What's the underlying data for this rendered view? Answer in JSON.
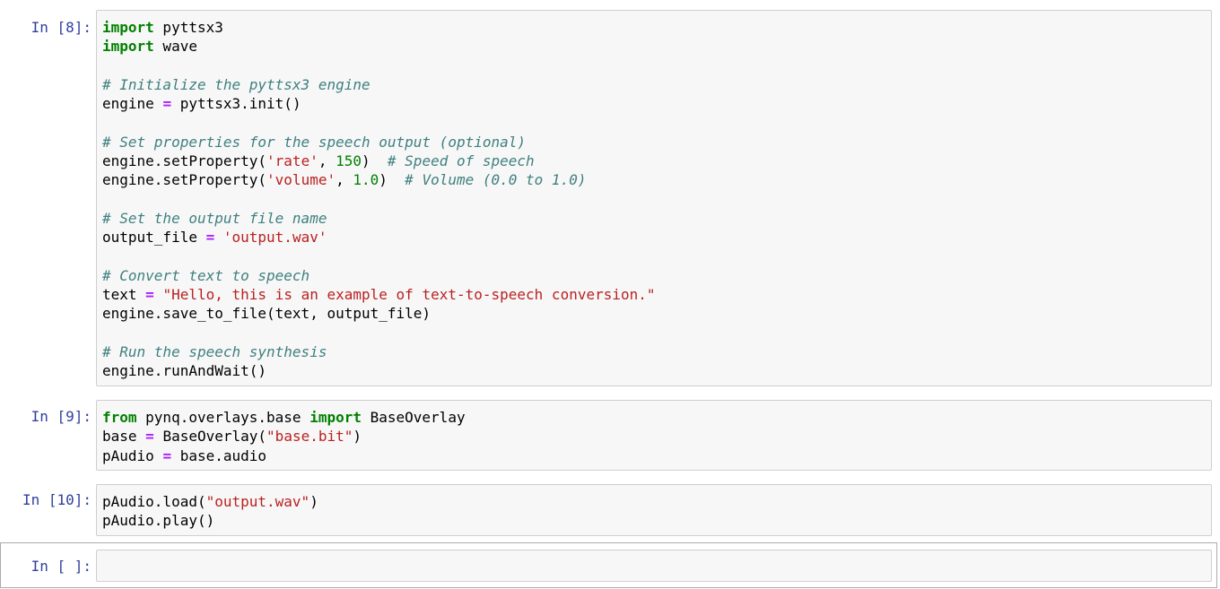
{
  "cells": [
    {
      "prompt": "In [8]:",
      "lines": [
        [
          {
            "t": "kw",
            "v": "import"
          },
          {
            "t": "",
            "v": " pyttsx3"
          }
        ],
        [
          {
            "t": "kw",
            "v": "import"
          },
          {
            "t": "",
            "v": " wave"
          }
        ],
        [],
        [
          {
            "t": "cm",
            "v": "# Initialize the pyttsx3 engine"
          }
        ],
        [
          {
            "t": "",
            "v": "engine "
          },
          {
            "t": "op",
            "v": "="
          },
          {
            "t": "",
            "v": " pyttsx3.init()"
          }
        ],
        [],
        [
          {
            "t": "cm",
            "v": "# Set properties for the speech output (optional)"
          }
        ],
        [
          {
            "t": "",
            "v": "engine.setProperty("
          },
          {
            "t": "st",
            "v": "'rate'"
          },
          {
            "t": "",
            "v": ", "
          },
          {
            "t": "nm",
            "v": "150"
          },
          {
            "t": "",
            "v": ")  "
          },
          {
            "t": "cm",
            "v": "# Speed of speech"
          }
        ],
        [
          {
            "t": "",
            "v": "engine.setProperty("
          },
          {
            "t": "st",
            "v": "'volume'"
          },
          {
            "t": "",
            "v": ", "
          },
          {
            "t": "nm",
            "v": "1.0"
          },
          {
            "t": "",
            "v": ")  "
          },
          {
            "t": "cm",
            "v": "# Volume (0.0 to 1.0)"
          }
        ],
        [],
        [
          {
            "t": "cm",
            "v": "# Set the output file name"
          }
        ],
        [
          {
            "t": "",
            "v": "output_file "
          },
          {
            "t": "op",
            "v": "="
          },
          {
            "t": "",
            "v": " "
          },
          {
            "t": "st",
            "v": "'output.wav'"
          }
        ],
        [],
        [
          {
            "t": "cm",
            "v": "# Convert text to speech"
          }
        ],
        [
          {
            "t": "",
            "v": "text "
          },
          {
            "t": "op",
            "v": "="
          },
          {
            "t": "",
            "v": " "
          },
          {
            "t": "st",
            "v": "\"Hello, this is an example of text-to-speech conversion.\""
          }
        ],
        [
          {
            "t": "",
            "v": "engine.save_to_file(text, output_file)"
          }
        ],
        [],
        [
          {
            "t": "cm",
            "v": "# Run the speech synthesis"
          }
        ],
        [
          {
            "t": "",
            "v": "engine.runAndWait()"
          }
        ]
      ]
    },
    {
      "prompt": "In [9]:",
      "lines": [
        [
          {
            "t": "kw",
            "v": "from"
          },
          {
            "t": "",
            "v": " pynq.overlays.base "
          },
          {
            "t": "kw",
            "v": "import"
          },
          {
            "t": "",
            "v": " BaseOverlay"
          }
        ],
        [
          {
            "t": "",
            "v": "base "
          },
          {
            "t": "op",
            "v": "="
          },
          {
            "t": "",
            "v": " BaseOverlay("
          },
          {
            "t": "st",
            "v": "\"base.bit\""
          },
          {
            "t": "",
            "v": ")"
          }
        ],
        [
          {
            "t": "",
            "v": "pAudio "
          },
          {
            "t": "op",
            "v": "="
          },
          {
            "t": "",
            "v": " base.audio"
          }
        ]
      ]
    },
    {
      "prompt": "In [10]:",
      "lines": [
        [
          {
            "t": "",
            "v": "pAudio.load("
          },
          {
            "t": "st",
            "v": "\"output.wav\""
          },
          {
            "t": "",
            "v": ")"
          }
        ],
        [
          {
            "t": "",
            "v": "pAudio.play()"
          }
        ]
      ]
    },
    {
      "prompt": "In [ ]:",
      "lines": []
    }
  ],
  "colors": {
    "prompt": "#303f9f",
    "keyword": "#008000",
    "comment": "#408080",
    "string": "#ba2121",
    "number": "#008000",
    "operator": "#aa22ff",
    "cell_bg": "#f7f7f7",
    "cell_border": "#cfcfcf"
  }
}
